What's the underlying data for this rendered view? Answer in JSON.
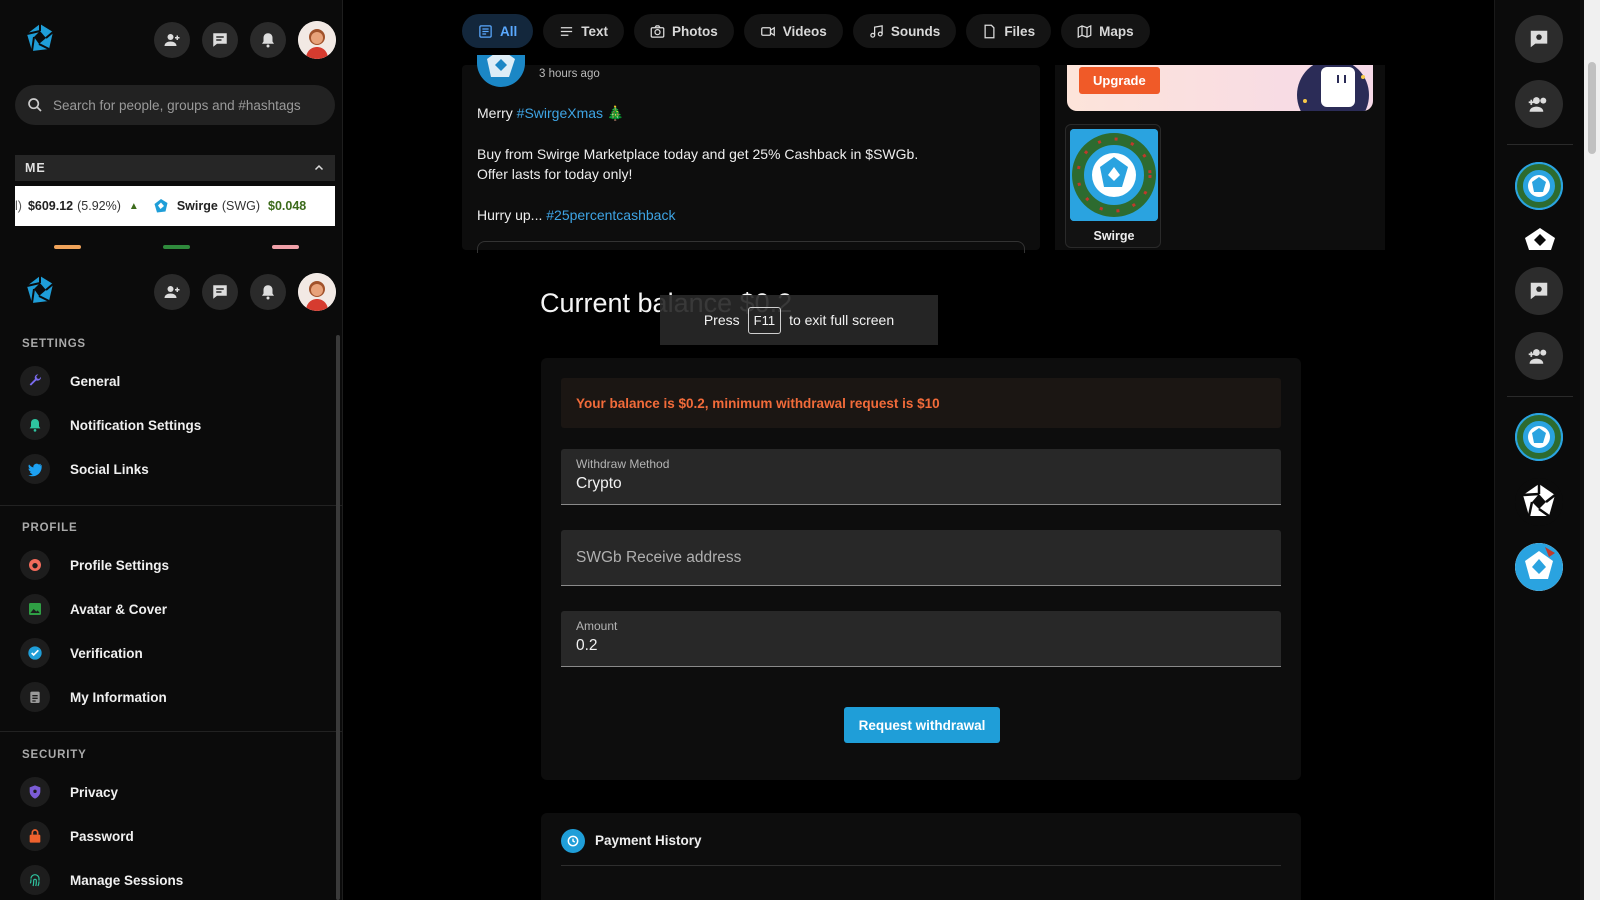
{
  "search": {
    "placeholder": "Search for people, groups and #hashtags"
  },
  "me_bar": {
    "label": "ME"
  },
  "ticker": {
    "item1_price": "$609.12",
    "item1_change": "(5.92%)",
    "item2_name": "Swirge",
    "item2_symbol": "(SWG)",
    "item2_price": "$0.048"
  },
  "sidebar": {
    "settings_label": "SETTINGS",
    "settings_items": [
      "General",
      "Notification Settings",
      "Social Links"
    ],
    "profile_label": "PROFILE",
    "profile_items": [
      "Profile Settings",
      "Avatar & Cover",
      "Verification",
      "My Information"
    ],
    "security_label": "SECURITY",
    "security_items": [
      "Privacy",
      "Password",
      "Manage Sessions"
    ]
  },
  "tabs": [
    "All",
    "Text",
    "Photos",
    "Videos",
    "Sounds",
    "Files",
    "Maps"
  ],
  "post": {
    "time": "3 hours ago",
    "line1_prefix": "Merry ",
    "line1_tag": "#SwirgeXmas",
    "line1_suffix": " 🎄",
    "line2": "Buy from Swirge Marketplace today and get 25% Cashback in $SWGb.",
    "line3": "Offer lasts for today only!",
    "line4_prefix": "Hurry up... ",
    "line4_tag": "#25percentcashback"
  },
  "promo": {
    "upgrade_label": "Upgrade",
    "card_name": "Swirge"
  },
  "balance": {
    "title": "Current balance $0.2"
  },
  "toast": {
    "press": "Press",
    "key": "F11",
    "rest": "to exit full screen"
  },
  "withdraw": {
    "alert": "Your balance is $0.2, minimum withdrawal request is $10",
    "method_label": "Withdraw Method",
    "method_value": "Crypto",
    "address_placeholder": "SWGb Receive address",
    "amount_label": "Amount",
    "amount_value": "0.2",
    "button": "Request withdrawal"
  },
  "history": {
    "title": "Payment History"
  },
  "colors": {
    "accent": "#1f9ed8",
    "alert": "#f26b3a",
    "tag": "#3ea4e4"
  }
}
